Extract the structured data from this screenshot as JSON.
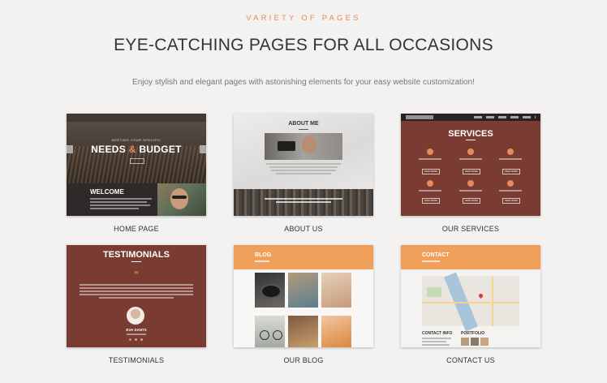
{
  "header": {
    "eyebrow": "VARIETY OF PAGES",
    "title": "EYE-CATCHING PAGES FOR ALL OCCASIONS",
    "subtitle": "Enjoy stylish and elegant pages with astonishing elements for your easy website customization!"
  },
  "cards": {
    "home": {
      "caption": "HOME PAGE",
      "small_heading": "MEETING YOUR SPECIFIC",
      "big_heading_left": "NEEDS",
      "big_heading_amp": "&",
      "big_heading_right": "BUDGET",
      "welcome": "WELCOME"
    },
    "about": {
      "caption": "ABOUT US",
      "heading": "ABOUT ME"
    },
    "services": {
      "caption": "OUR SERVICES",
      "heading": "SERVICES",
      "button": "READ MORE"
    },
    "testimonials": {
      "caption": "TESTIMONIALS",
      "heading": "TESTIMONIALS",
      "quote_mark": "”",
      "person": "EVA SANTS"
    },
    "blog": {
      "caption": "OUR BLOG",
      "heading": "BLOG"
    },
    "contact": {
      "caption": "CONTACT US",
      "heading": "CONTACT",
      "info": "CONTACT INFO",
      "portfolio": "PORTFOLIO"
    }
  },
  "colors": {
    "accent": "#e8895a",
    "brick": "#7a3b32",
    "orange_bar": "#f0a05a"
  }
}
